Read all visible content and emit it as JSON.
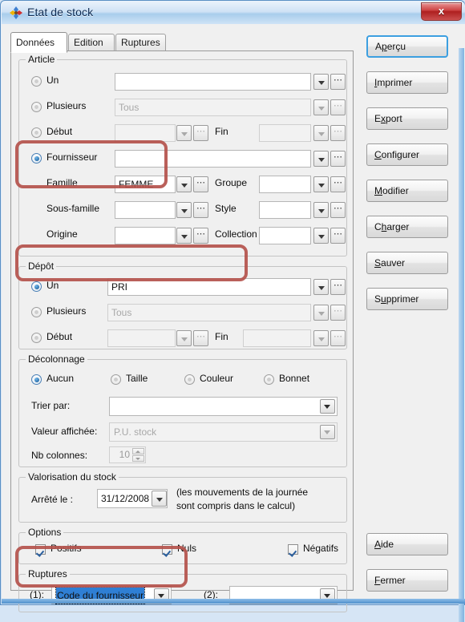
{
  "window": {
    "title": "Etat de stock",
    "icon": "app-pinwheel-icon",
    "close_label": "x",
    "accent": "#2f7fd4",
    "annotation_color": "#b4534c"
  },
  "tabs": [
    {
      "label": "Données",
      "active": true
    },
    {
      "label": "Edition",
      "active": false
    },
    {
      "label": "Ruptures",
      "active": false
    }
  ],
  "article": {
    "title": "Article",
    "rows": {
      "un": {
        "label": "Un",
        "value": "",
        "selected": false
      },
      "plusieurs": {
        "label": "Plusieurs",
        "value": "Tous",
        "selected": false
      },
      "debut": {
        "label": "Début",
        "value": "",
        "selected": false
      },
      "fin": {
        "label": "Fin",
        "value": ""
      },
      "fournisseur": {
        "label": "Fournisseur",
        "value": "",
        "selected": true
      },
      "famille": {
        "label": "Famille",
        "value": "FEMME"
      },
      "groupe": {
        "label": "Groupe",
        "value": ""
      },
      "sous_famille": {
        "label": "Sous-famille",
        "value": ""
      },
      "style": {
        "label": "Style",
        "value": ""
      },
      "origine": {
        "label": "Origine",
        "value": ""
      },
      "collection": {
        "label": "Collection",
        "value": ""
      }
    }
  },
  "depot": {
    "title": "Dépôt",
    "rows": {
      "un": {
        "label": "Un",
        "value": "PRI",
        "selected": true
      },
      "plusieurs": {
        "label": "Plusieurs",
        "value": "Tous",
        "selected": false
      },
      "debut": {
        "label": "Début",
        "value": "",
        "selected": false
      },
      "fin": {
        "label": "Fin",
        "value": ""
      }
    }
  },
  "decolonnage": {
    "title": "Décolonnage",
    "options": [
      {
        "label": "Aucun",
        "selected": true
      },
      {
        "label": "Taille",
        "selected": false
      },
      {
        "label": "Couleur",
        "selected": false
      },
      {
        "label": "Bonnet",
        "selected": false
      }
    ],
    "trier_par": {
      "label": "Trier par:",
      "value": ""
    },
    "valeur_affichee": {
      "label": "Valeur affichée:",
      "value": "P.U. stock"
    },
    "nb_colonnes": {
      "label": "Nb colonnes:",
      "value": "10"
    }
  },
  "valorisation": {
    "title": "Valorisation du stock",
    "arrete_label": "Arrêté le :",
    "date_value": "31/12/2008",
    "note_line1": "(les mouvements de la journée",
    "note_line2": "sont compris dans le calcul)"
  },
  "options": {
    "title": "Options",
    "items": [
      {
        "label": "Positifs",
        "checked": true
      },
      {
        "label": "Nuls",
        "checked": true
      },
      {
        "label": "Négatifs",
        "checked": true
      }
    ]
  },
  "ruptures": {
    "title": "Ruptures",
    "first": {
      "label": "(1):",
      "value": "Code du fournisseur",
      "focused": true
    },
    "second": {
      "label": "(2):",
      "value": "",
      "focused": false
    }
  },
  "buttons": [
    {
      "name": "apercu",
      "pre": "A",
      "mn": "p",
      "post": "erçu",
      "default": true
    },
    {
      "name": "imprimer",
      "pre": "",
      "mn": "I",
      "post": "mprimer",
      "default": false
    },
    {
      "name": "export",
      "pre": "E",
      "mn": "x",
      "post": "port",
      "default": false
    },
    {
      "name": "configurer",
      "pre": "",
      "mn": "C",
      "post": "onfigurer",
      "default": false
    },
    {
      "name": "modifier",
      "pre": "",
      "mn": "M",
      "post": "odifier",
      "default": false
    },
    {
      "name": "charger",
      "pre": "C",
      "mn": "h",
      "post": "arger",
      "default": false
    },
    {
      "name": "sauver",
      "pre": "",
      "mn": "S",
      "post": "auver",
      "default": false
    },
    {
      "name": "supprimer",
      "pre": "S",
      "mn": "u",
      "post": "pprimer",
      "default": false
    },
    {
      "name": "aide",
      "pre": "",
      "mn": "A",
      "post": "ide",
      "default": false
    },
    {
      "name": "fermer",
      "pre": "",
      "mn": "F",
      "post": "ermer",
      "default": false
    }
  ]
}
